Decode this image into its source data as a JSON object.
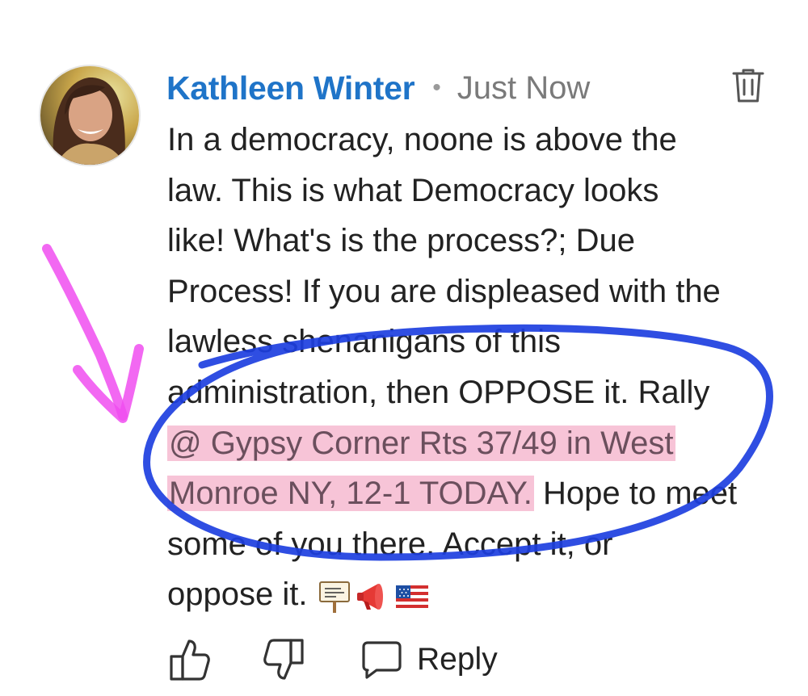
{
  "comment": {
    "author": "Kathleen Winter",
    "separator": "•",
    "timestamp": "Just Now",
    "body_lines": [
      "In a democracy, noone is above the",
      "law. This is what Democracy looks",
      "like! What's is the process?; Due",
      "Process! If you are displeased with the",
      "lawless shenanigans of this",
      "administration, then OPPOSE it. Rally"
    ],
    "highlight_line": "@ Gypsy Corner Rts 37/49 in West",
    "highlight_start": "Monroe NY, 12-1 TODAY.",
    "after_highlight": " Hope to meet",
    "line_9": "some of you there. Accept it, or",
    "line_10": "oppose it.",
    "emojis": [
      "placard-emoji",
      "megaphone-emoji",
      "us-flag-emoji"
    ]
  },
  "actions": {
    "reply_label": "Reply"
  },
  "colors": {
    "author": "#1f74c8",
    "highlight": "#f7c4d7",
    "annotation_circle": "#1d3fe0",
    "annotation_arrow": "#f04ef0"
  },
  "icons": {
    "delete": "trash-icon",
    "like": "thumbs-up-icon",
    "dislike": "thumbs-down-icon",
    "reply": "speech-bubble-icon"
  }
}
